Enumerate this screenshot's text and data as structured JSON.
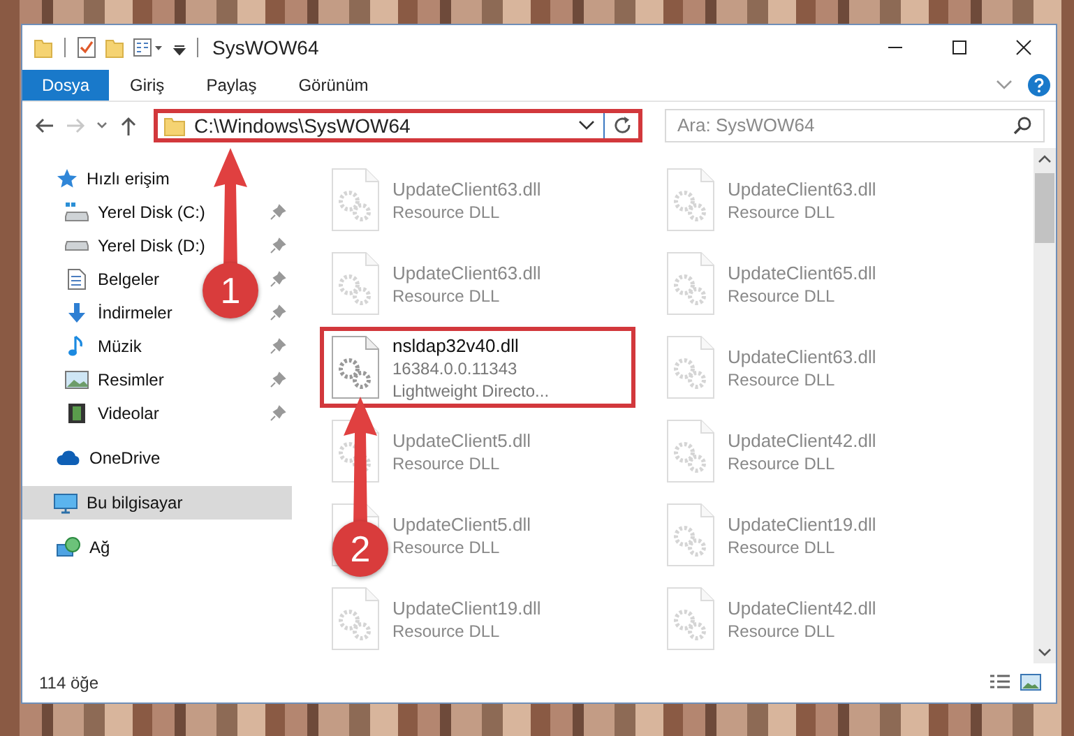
{
  "window": {
    "title": "SysWOW64"
  },
  "ribbon_tabs": [
    {
      "label": "Dosya",
      "selected": true
    },
    {
      "label": "Giriş",
      "selected": false
    },
    {
      "label": "Paylaş",
      "selected": false
    },
    {
      "label": "Görünüm",
      "selected": false
    }
  ],
  "navigation": {
    "forward_disabled": true
  },
  "address_bar": {
    "value": "C:\\Windows\\SysWOW64",
    "highlighted": true
  },
  "search": {
    "placeholder": "Ara: SysWOW64"
  },
  "sidebar": {
    "items": [
      {
        "label": "Hızlı erişim",
        "selected": false,
        "children": [
          {
            "label": "Yerel Disk (C:)",
            "pinned": true
          },
          {
            "label": "Yerel Disk (D:)",
            "pinned": true
          },
          {
            "label": "Belgeler",
            "pinned": true
          },
          {
            "label": "İndirmeler",
            "pinned": true
          },
          {
            "label": "Müzik",
            "pinned": true
          },
          {
            "label": "Resimler",
            "pinned": true
          },
          {
            "label": "Videolar",
            "pinned": true
          }
        ]
      },
      {
        "label": "OneDrive",
        "selected": false
      },
      {
        "label": "Bu bilgisayar",
        "selected": true
      },
      {
        "label": "Ağ",
        "selected": false
      }
    ]
  },
  "files": [
    {
      "name": "UpdateClient63.dll",
      "details": [
        "Resource DLL"
      ],
      "faded": true,
      "highlighted": false
    },
    {
      "name": "UpdateClient63.dll",
      "details": [
        "Resource DLL"
      ],
      "faded": true,
      "highlighted": false
    },
    {
      "name": "UpdateClient63.dll",
      "details": [
        "Resource DLL"
      ],
      "faded": true,
      "highlighted": false
    },
    {
      "name": "UpdateClient65.dll",
      "details": [
        "Resource DLL"
      ],
      "faded": true,
      "highlighted": false
    },
    {
      "name": "nsldap32v40.dll",
      "details": [
        "16384.0.0.11343",
        "Lightweight Directo..."
      ],
      "faded": false,
      "highlighted": true
    },
    {
      "name": "UpdateClient63.dll",
      "details": [
        "Resource DLL"
      ],
      "faded": true,
      "highlighted": false
    },
    {
      "name": "UpdateClient5.dll",
      "details": [
        "Resource DLL"
      ],
      "faded": true,
      "highlighted": false
    },
    {
      "name": "UpdateClient42.dll",
      "details": [
        "Resource DLL"
      ],
      "faded": true,
      "highlighted": false
    },
    {
      "name": "UpdateClient5.dll",
      "details": [
        "Resource DLL"
      ],
      "faded": true,
      "highlighted": false
    },
    {
      "name": "UpdateClient19.dll",
      "details": [
        "Resource DLL"
      ],
      "faded": true,
      "highlighted": false
    },
    {
      "name": "UpdateClient19.dll",
      "details": [
        "Resource DLL"
      ],
      "faded": true,
      "highlighted": false
    },
    {
      "name": "UpdateClient42.dll",
      "details": [
        "Resource DLL"
      ],
      "faded": true,
      "highlighted": false
    }
  ],
  "status_bar": {
    "item_count": "114 öğe"
  },
  "annotations": [
    {
      "label": "1"
    },
    {
      "label": "2"
    }
  ]
}
